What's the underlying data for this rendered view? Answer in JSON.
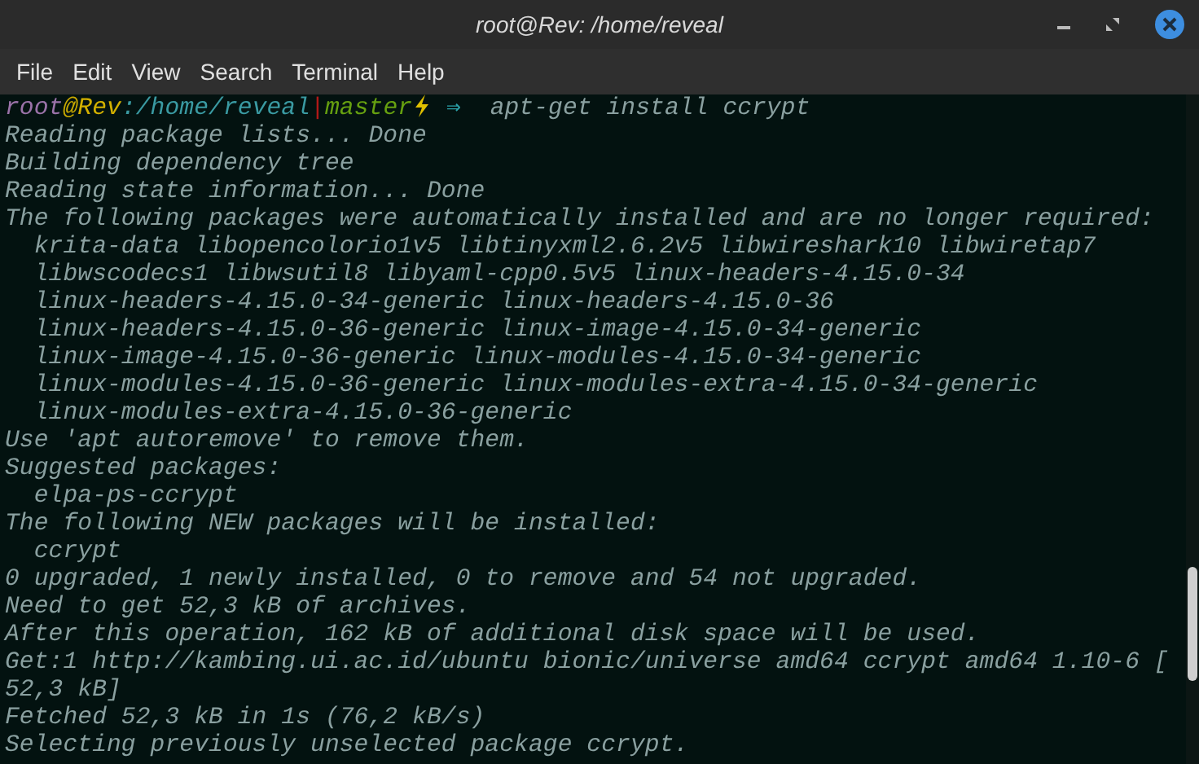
{
  "window": {
    "title": "root@Rev: /home/reveal"
  },
  "menu": [
    "File",
    "Edit",
    "View",
    "Search",
    "Terminal",
    "Help"
  ],
  "prompt": [
    {
      "text": "root",
      "color": "#9a72a8"
    },
    {
      "text": "@",
      "color": "#c8a800"
    },
    {
      "text": "Rev",
      "color": "#d2b000"
    },
    {
      "text": ":/home/reveal",
      "color": "#3a9aa2"
    },
    {
      "text": "|",
      "color": "#b01818"
    },
    {
      "text": "master",
      "color": "#66a010"
    },
    {
      "kind": "icon",
      "color": "#e0c000"
    },
    {
      "text": " ⇒ ",
      "color": "#2aa0a8"
    },
    {
      "text": " apt-get install ccrypt",
      "color": "#8aa0a0"
    }
  ],
  "output": [
    "Reading package lists... Done",
    "Building dependency tree",
    "Reading state information... Done",
    "The following packages were automatically installed and are no longer required:",
    "  krita-data libopencolorio1v5 libtinyxml2.6.2v5 libwireshark10 libwiretap7",
    "  libwscodecs1 libwsutil8 libyaml-cpp0.5v5 linux-headers-4.15.0-34",
    "  linux-headers-4.15.0-34-generic linux-headers-4.15.0-36",
    "  linux-headers-4.15.0-36-generic linux-image-4.15.0-34-generic",
    "  linux-image-4.15.0-36-generic linux-modules-4.15.0-34-generic",
    "  linux-modules-4.15.0-36-generic linux-modules-extra-4.15.0-34-generic",
    "  linux-modules-extra-4.15.0-36-generic",
    "Use 'apt autoremove' to remove them.",
    "Suggested packages:",
    "  elpa-ps-ccrypt",
    "The following NEW packages will be installed:",
    "  ccrypt",
    "0 upgraded, 1 newly installed, 0 to remove and 54 not upgraded.",
    "Need to get 52,3 kB of archives.",
    "After this operation, 162 kB of additional disk space will be used.",
    "Get:1 http://kambing.ui.ac.id/ubuntu bionic/universe amd64 ccrypt amd64 1.10-6 [",
    "52,3 kB]",
    "Fetched 52,3 kB in 1s (76,2 kB/s)",
    "Selecting previously unselected package ccrypt."
  ]
}
